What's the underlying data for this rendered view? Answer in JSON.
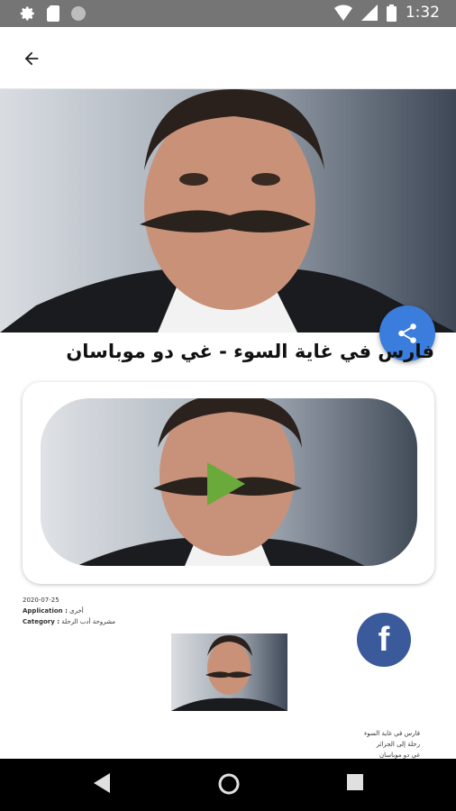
{
  "status_bar": {
    "time": "1:32",
    "icons": [
      "settings-icon",
      "sd-card-icon",
      "dot-icon",
      "wifi-icon",
      "signal-icon",
      "battery-icon"
    ]
  },
  "app_bar": {
    "back_icon": "arrow-left-icon"
  },
  "article": {
    "title": "فارس في غاية السوء - غي دو موباسان"
  },
  "meta": {
    "date": "2020-07-25",
    "application_label": "Application :",
    "application_value": "أخرى",
    "category_label": "Category :",
    "category_value": "مشروحة أدب الرحلة"
  },
  "related_links": [
    "فارس في غاية السوء",
    "رحلة إلى الجزائر",
    "غي دو موباسان"
  ],
  "colors": {
    "share_fab": "#3b7ddd",
    "facebook_fab": "#3a5a9c",
    "play_button": "#6aaa3a",
    "status_bar": "#757575",
    "nav_bar": "#000000"
  }
}
